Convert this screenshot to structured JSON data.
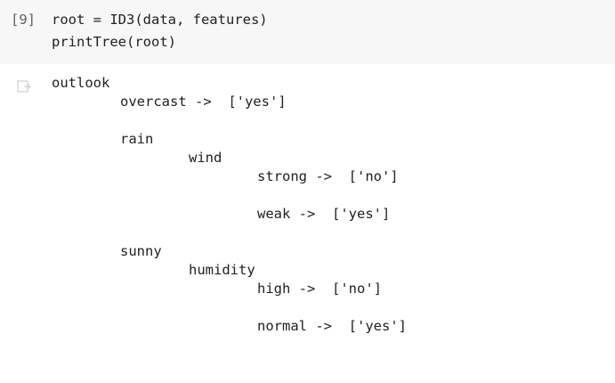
{
  "cell": {
    "execution_count": "[9]",
    "code_lines": [
      "root = ID3(data, features)",
      "printTree(root)"
    ]
  },
  "output": {
    "icon": "output-clear-icon",
    "lines": [
      "outlook",
      "overcast ->  ['yes']",
      "rain",
      "wind",
      "strong ->  ['no']",
      "weak ->  ['yes']",
      "sunny",
      "humidity",
      "high ->  ['no']",
      "normal ->  ['yes']"
    ]
  }
}
